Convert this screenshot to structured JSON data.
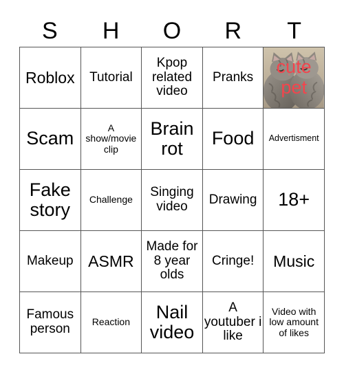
{
  "header": {
    "letters": [
      "S",
      "H",
      "O",
      "R",
      "T"
    ]
  },
  "grid": {
    "rows": 5,
    "cols": 5,
    "cells": [
      {
        "text": "Roblox",
        "size": "fs-lg",
        "type": "text"
      },
      {
        "text": "Tutorial",
        "size": "fs-md",
        "type": "text"
      },
      {
        "text": "Kpop related video",
        "size": "fs-md",
        "type": "text"
      },
      {
        "text": "Pranks",
        "size": "fs-md",
        "type": "text"
      },
      {
        "text": "cute pet",
        "size": "fs-xl",
        "type": "photo",
        "image": "two-kittens-cuddling-photo",
        "text_color": "#f4444c"
      },
      {
        "text": "Scam",
        "size": "fs-xl",
        "type": "text"
      },
      {
        "text": "A show/movie clip",
        "size": "fs-sm",
        "type": "text"
      },
      {
        "text": "Brain rot",
        "size": "fs-xl",
        "type": "text"
      },
      {
        "text": "Food",
        "size": "fs-xl",
        "type": "text"
      },
      {
        "text": "Advertisment",
        "size": "fs-xs",
        "type": "text"
      },
      {
        "text": "Fake story",
        "size": "fs-xl",
        "type": "text"
      },
      {
        "text": "Challenge",
        "size": "fs-sm",
        "type": "text"
      },
      {
        "text": "Singing video",
        "size": "fs-md",
        "type": "text"
      },
      {
        "text": "Drawing",
        "size": "fs-md",
        "type": "text"
      },
      {
        "text": "18+",
        "size": "fs-xl",
        "type": "text"
      },
      {
        "text": "Makeup",
        "size": "fs-md",
        "type": "text"
      },
      {
        "text": "ASMR",
        "size": "fs-lg",
        "type": "text"
      },
      {
        "text": "Made for 8 year olds",
        "size": "fs-md",
        "type": "text"
      },
      {
        "text": "Cringe!",
        "size": "fs-md",
        "type": "text"
      },
      {
        "text": "Music",
        "size": "fs-lg",
        "type": "text"
      },
      {
        "text": "Famous person",
        "size": "fs-md",
        "type": "text"
      },
      {
        "text": "Reaction",
        "size": "fs-sm",
        "type": "text"
      },
      {
        "text": "Nail video",
        "size": "fs-xl",
        "type": "text"
      },
      {
        "text": "A youtuber i like",
        "size": "fs-md",
        "type": "text"
      },
      {
        "text": "Video with low amount of likes",
        "size": "fs-sm",
        "type": "text"
      }
    ]
  },
  "colors": {
    "grid_line": "#555555",
    "background": "#ffffff",
    "text": "#000000",
    "photo_text": "#f4444c"
  }
}
